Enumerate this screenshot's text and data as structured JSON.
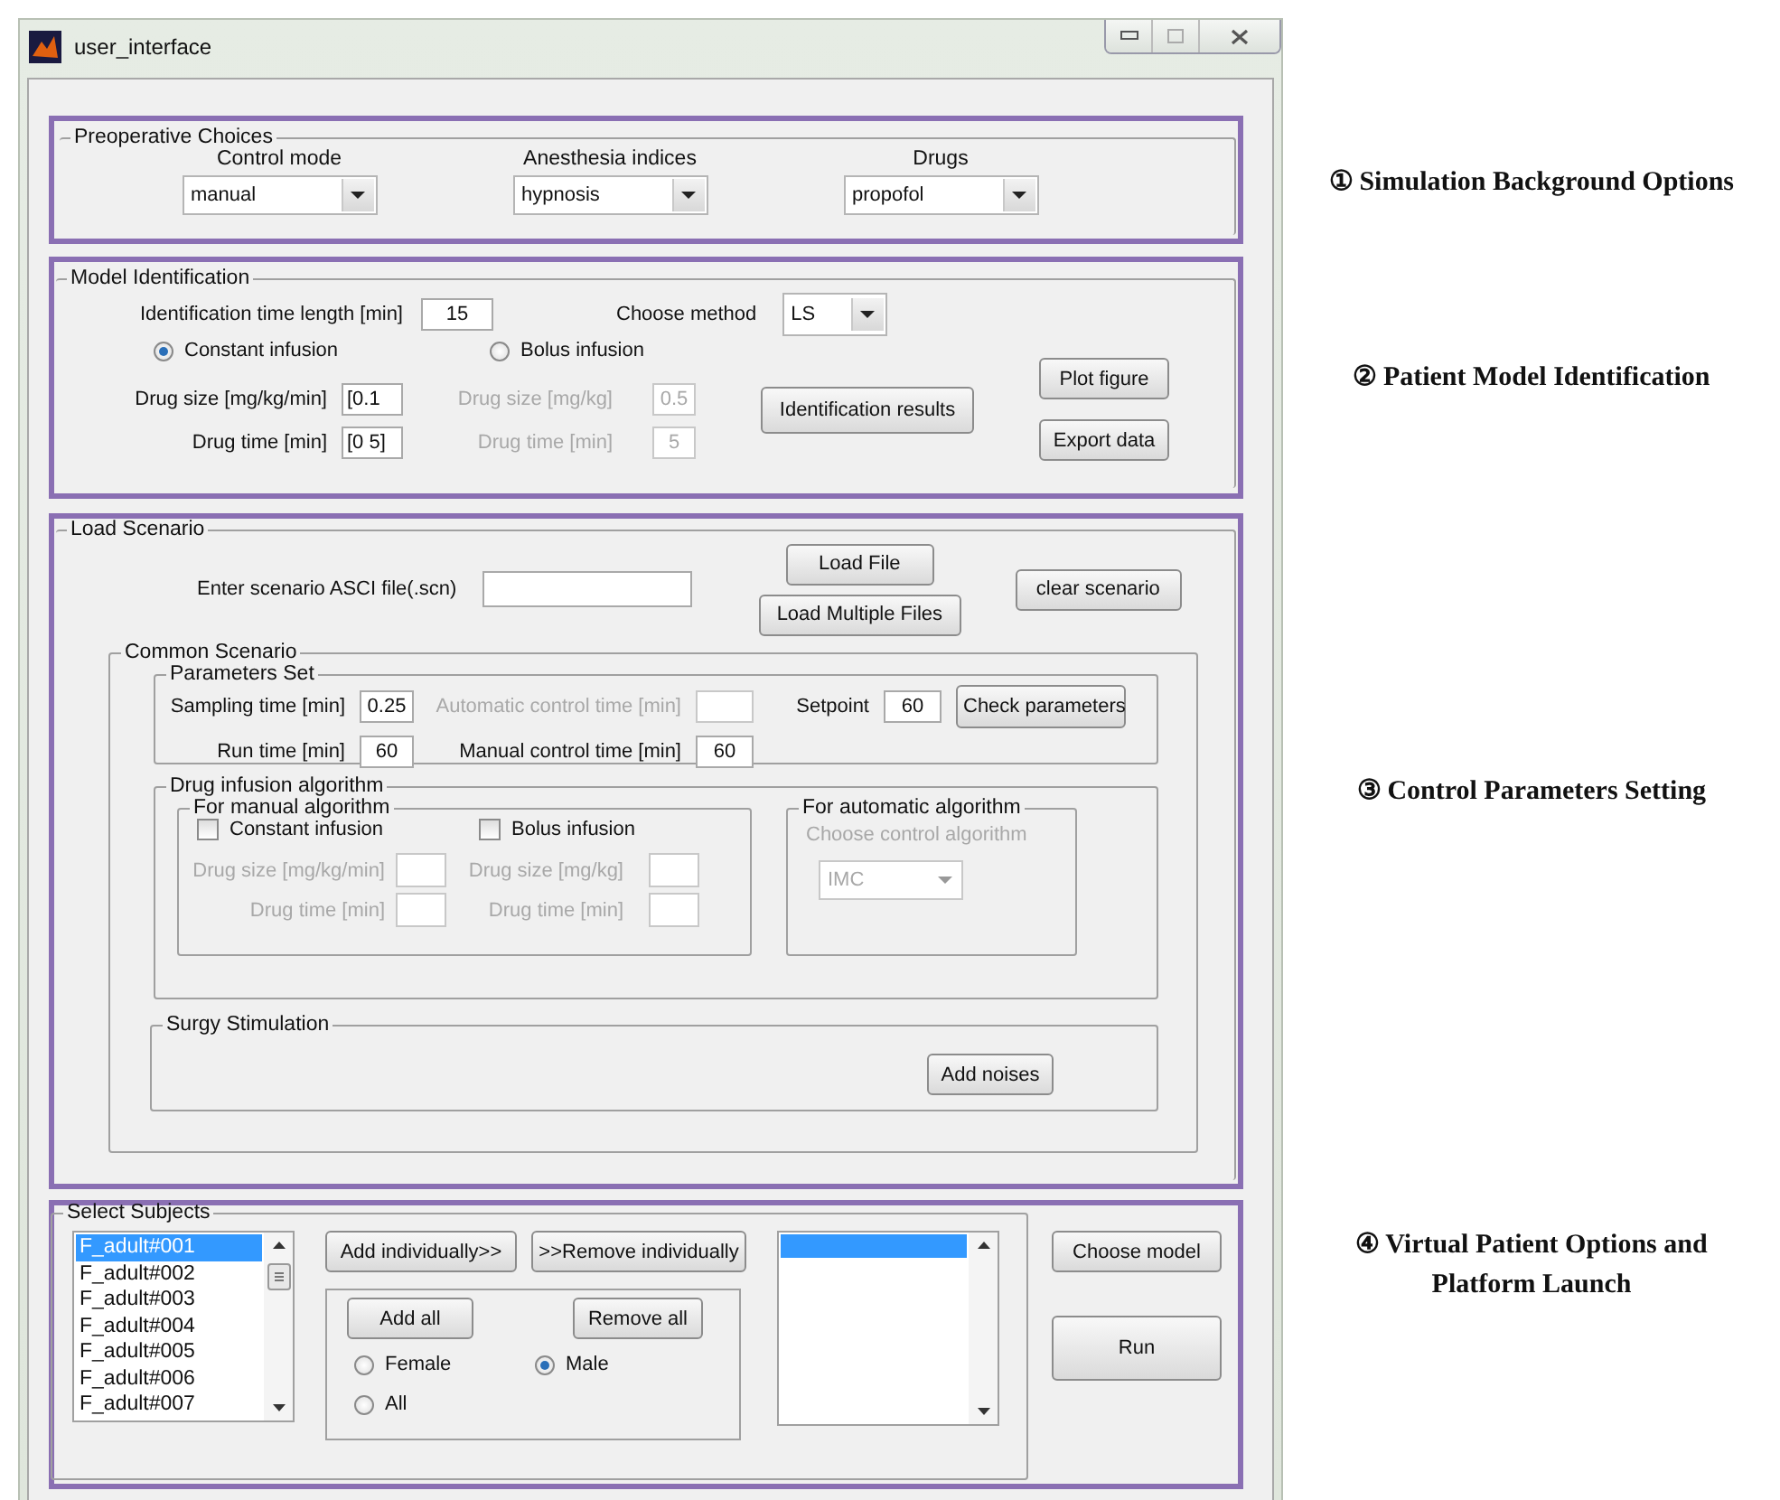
{
  "window": {
    "title": "user_interface"
  },
  "preoperative": {
    "title": "Preoperative Choices",
    "dropdowns": [
      {
        "label": "Control mode",
        "value": "manual"
      },
      {
        "label": "Anesthesia indices",
        "value": "hypnosis"
      },
      {
        "label": "Drugs",
        "value": "propofol"
      }
    ]
  },
  "model_identification": {
    "title": "Model Identification",
    "time_length_label": "Identification time length [min]",
    "time_length_value": "15",
    "method_label": "Choose method",
    "method_value": "LS",
    "radios": [
      {
        "label": "Constant infusion",
        "selected": true
      },
      {
        "label": "Bolus infusion",
        "selected": false
      }
    ],
    "field_groups": [
      {
        "fields": [
          {
            "label": "Drug size [mg/kg/min]",
            "value": "[0.1",
            "disabled": false
          },
          {
            "label": "Drug time [min]",
            "value": "[0 5]",
            "disabled": false
          }
        ]
      },
      {
        "fields": [
          {
            "label": "Drug size [mg/kg]",
            "value": "0.5",
            "disabled": true
          },
          {
            "label": "Drug time [min]",
            "value": "5",
            "disabled": true
          }
        ]
      }
    ],
    "results_button": "Identification results",
    "plot_button": "Plot figure",
    "export_button": "Export data"
  },
  "load_scenario": {
    "title": "Load Scenario",
    "file_label": "Enter scenario ASCI file(.scn)",
    "load_file_button": "Load File",
    "load_multiple_button": "Load Multiple Files",
    "clear_button": "clear scenario",
    "common_scenario": {
      "title": "Common Scenario",
      "parameters_set": {
        "title": "Parameters Set",
        "rows": [
          {
            "fields": [
              {
                "label": "Sampling time [min]",
                "value": "0.25",
                "disabled": false
              },
              {
                "label": "Automatic control time [min]",
                "disabled": true
              },
              {
                "label": "Setpoint",
                "value": "60",
                "disabled": false
              }
            ]
          },
          {
            "fields": [
              {
                "label": "Run time [min]",
                "value": "60",
                "disabled": false
              },
              {
                "label": "Manual control time [min]",
                "value": "60",
                "disabled": false
              }
            ]
          }
        ],
        "check_button": "Check parameters"
      },
      "drug_infusion": {
        "title": "Drug infusion algorithm",
        "manual": {
          "title": "For manual algorithm",
          "options": [
            {
              "label": "Constant infusion",
              "checked": false,
              "fields": [
                {
                  "label": "Drug size [mg/kg/min]",
                  "disabled": true
                },
                {
                  "label": "Drug time [min]",
                  "disabled": true
                }
              ]
            },
            {
              "label": "Bolus infusion",
              "checked": false,
              "fields": [
                {
                  "label": "Drug size [mg/kg]",
                  "disabled": true
                },
                {
                  "label": "Drug time [min]",
                  "disabled": true
                }
              ]
            }
          ]
        },
        "automatic": {
          "title": "For automatic algorithm",
          "label": "Choose control algorithm",
          "value": "IMC",
          "disabled": true
        }
      },
      "surgery": {
        "title": "Surgy Stimulation",
        "button": "Add noises"
      }
    }
  },
  "select_subjects": {
    "title": "Select Subjects",
    "subjects": [
      {
        "name": "F_adult#001",
        "selected": true
      },
      {
        "name": "F_adult#002",
        "selected": false
      },
      {
        "name": "F_adult#003",
        "selected": false
      },
      {
        "name": "F_adult#004",
        "selected": false
      },
      {
        "name": "F_adult#005",
        "selected": false
      },
      {
        "name": "F_adult#006",
        "selected": false
      },
      {
        "name": "F_adult#007",
        "selected": false
      }
    ],
    "add_individually_button": "Add individually>>",
    "remove_individually_button": ">>Remove individually",
    "add_all_button": "Add all",
    "remove_all_button": "Remove all",
    "gender_radios": [
      {
        "label": "Female",
        "selected": false
      },
      {
        "label": "Male",
        "selected": true
      },
      {
        "label": "All",
        "selected": false
      }
    ],
    "choose_model_button": "Choose model",
    "run_button": "Run"
  },
  "annotations": [
    {
      "text": "① Simulation Background Options"
    },
    {
      "text": "② Patient Model Identification"
    },
    {
      "text": "③ Control Parameters Setting"
    },
    {
      "text": "④ Virtual Patient Options and Platform Launch"
    }
  ]
}
